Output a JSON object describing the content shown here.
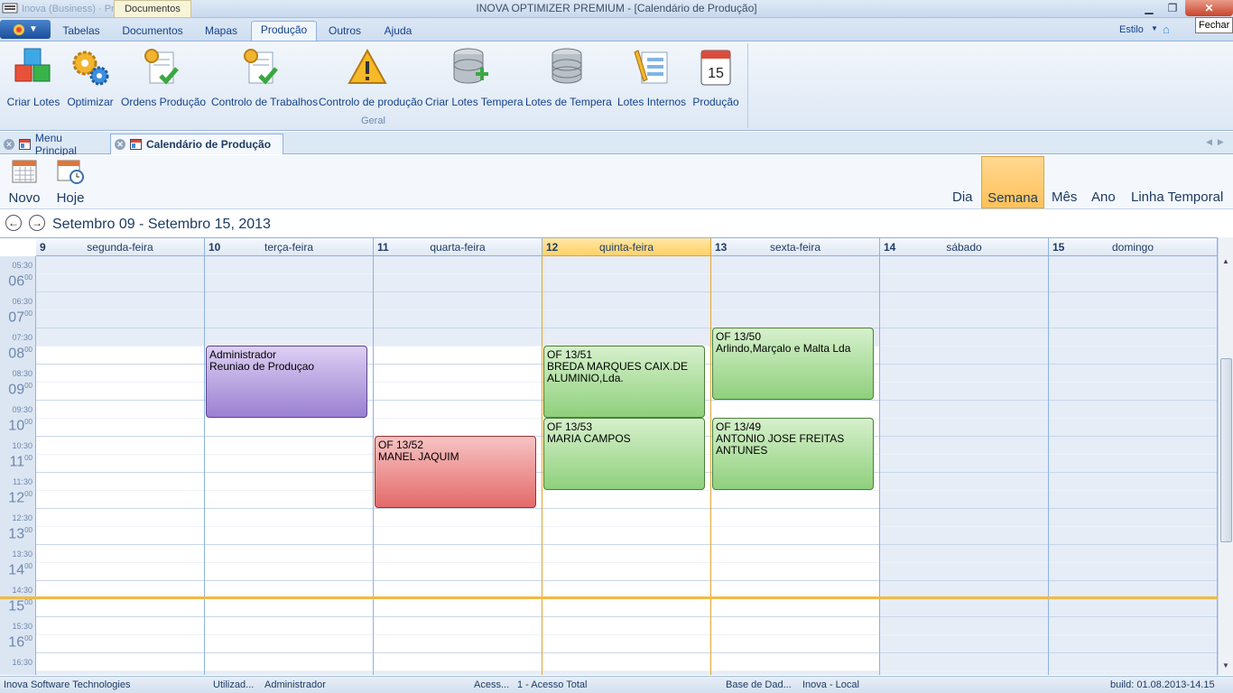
{
  "titlebar": {
    "title": "INOVA OPTIMIZER PREMIUM - [Calendário de Produção]",
    "ghost_text": "Inova (Business) · Principal · Studio",
    "tooltip_top": "Documentos",
    "close_tooltip": "Fechar"
  },
  "ribbon_tabs": {
    "items": [
      "Tabelas",
      "Documentos",
      "Mapas",
      "Produção",
      "Outros",
      "Ajuda"
    ],
    "active": "Produção",
    "estilo": "Estilo"
  },
  "ribbon": {
    "buttons": [
      {
        "label": "Criar Lotes",
        "icon": "cubes-icon"
      },
      {
        "label": "Optimizar",
        "icon": "gears-icon"
      },
      {
        "label": "Ordens Produção",
        "icon": "orders-check-icon"
      },
      {
        "label": "Controlo de Trabalhos",
        "icon": "work-control-icon"
      },
      {
        "label": "Controlo de produção",
        "icon": "warning-icon"
      },
      {
        "label": "Criar Lotes Tempera",
        "icon": "database-add-icon"
      },
      {
        "label": "Lotes de Tempera",
        "icon": "database-icon"
      },
      {
        "label": "Lotes Internos",
        "icon": "pencil-list-icon"
      },
      {
        "label": "Produção",
        "icon": "calendar-15-icon"
      }
    ],
    "group_label": "Geral"
  },
  "doc_tabs": {
    "items": [
      "Menu Principal",
      "Calendário de Produção"
    ],
    "active": "Calendário de Produção"
  },
  "cal_toolbar": {
    "novo": "Novo",
    "hoje": "Hoje",
    "views": [
      "Dia",
      "Semana",
      "Mês",
      "Ano",
      "Linha Temporal"
    ],
    "active_view": "Semana"
  },
  "date_range": "Setembro 09 - Setembro 15, 2013",
  "days": [
    {
      "num": "9",
      "name": "segunda-feira"
    },
    {
      "num": "10",
      "name": "terça-feira"
    },
    {
      "num": "11",
      "name": "quarta-feira"
    },
    {
      "num": "12",
      "name": "quinta-feira",
      "today": true
    },
    {
      "num": "13",
      "name": "sexta-feira"
    },
    {
      "num": "14",
      "name": "sábado"
    },
    {
      "num": "15",
      "name": "domingo"
    }
  ],
  "time_labels": [
    {
      "text": "05:30",
      "type": "half"
    },
    {
      "text": "06",
      "sup": "00",
      "type": "hour"
    },
    {
      "text": "06:30",
      "type": "half"
    },
    {
      "text": "07",
      "sup": "00",
      "type": "hour"
    },
    {
      "text": "07:30",
      "type": "half"
    },
    {
      "text": "08",
      "sup": "00",
      "type": "hour"
    },
    {
      "text": "08:30",
      "type": "half"
    },
    {
      "text": "09",
      "sup": "00",
      "type": "hour"
    },
    {
      "text": "09:30",
      "type": "half"
    },
    {
      "text": "10",
      "sup": "00",
      "type": "hour"
    },
    {
      "text": "10:30",
      "type": "half"
    },
    {
      "text": "11",
      "sup": "00",
      "type": "hour"
    },
    {
      "text": "11:30",
      "type": "half"
    },
    {
      "text": "12",
      "sup": "00",
      "type": "hour"
    },
    {
      "text": "12:30",
      "type": "half"
    },
    {
      "text": "13",
      "sup": "00",
      "type": "hour"
    },
    {
      "text": "13:30",
      "type": "half"
    },
    {
      "text": "14",
      "sup": "00",
      "type": "hour"
    },
    {
      "text": "14:30",
      "type": "half"
    },
    {
      "text": "15",
      "sup": "00",
      "type": "hour"
    },
    {
      "text": "15:30",
      "type": "half"
    },
    {
      "text": "16",
      "sup": "00",
      "type": "hour"
    },
    {
      "text": "16:30",
      "type": "half"
    }
  ],
  "appointments": [
    {
      "day": 1,
      "start": "08:00",
      "end": "10:00",
      "color": "purple",
      "line1": "Administrador",
      "line2": "Reuniao de Produçao"
    },
    {
      "day": 2,
      "start": "10:30",
      "end": "12:30",
      "color": "red",
      "line1": "OF 13/52",
      "line2": "MANEL JAQUIM"
    },
    {
      "day": 3,
      "start": "08:00",
      "end": "10:00",
      "color": "green",
      "line1": "OF 13/51",
      "line2": "BREDA MARQUES CAIX.DE ALUMINIO,Lda."
    },
    {
      "day": 3,
      "start": "10:00",
      "end": "12:00",
      "color": "green",
      "line1": "OF 13/53",
      "line2": "MARIA CAMPOS"
    },
    {
      "day": 4,
      "start": "07:30",
      "end": "09:30",
      "color": "green",
      "line1": "OF 13/50",
      "line2": "Arlindo,Marçalo e Malta Lda"
    },
    {
      "day": 4,
      "start": "10:00",
      "end": "12:00",
      "color": "green",
      "line1": "OF 13/49",
      "line2": "ANTONIO JOSE FREITAS ANTUNES"
    }
  ],
  "statusbar": {
    "company": "Inova Software Technologies",
    "user_label": "Utilizad...",
    "user": "Administrador",
    "access_label": "Acess...",
    "access": "1 - Acesso Total",
    "db_label": "Base de Dad...",
    "db": "Inova - Local",
    "build": "build: 01.08.2013-14.15"
  }
}
